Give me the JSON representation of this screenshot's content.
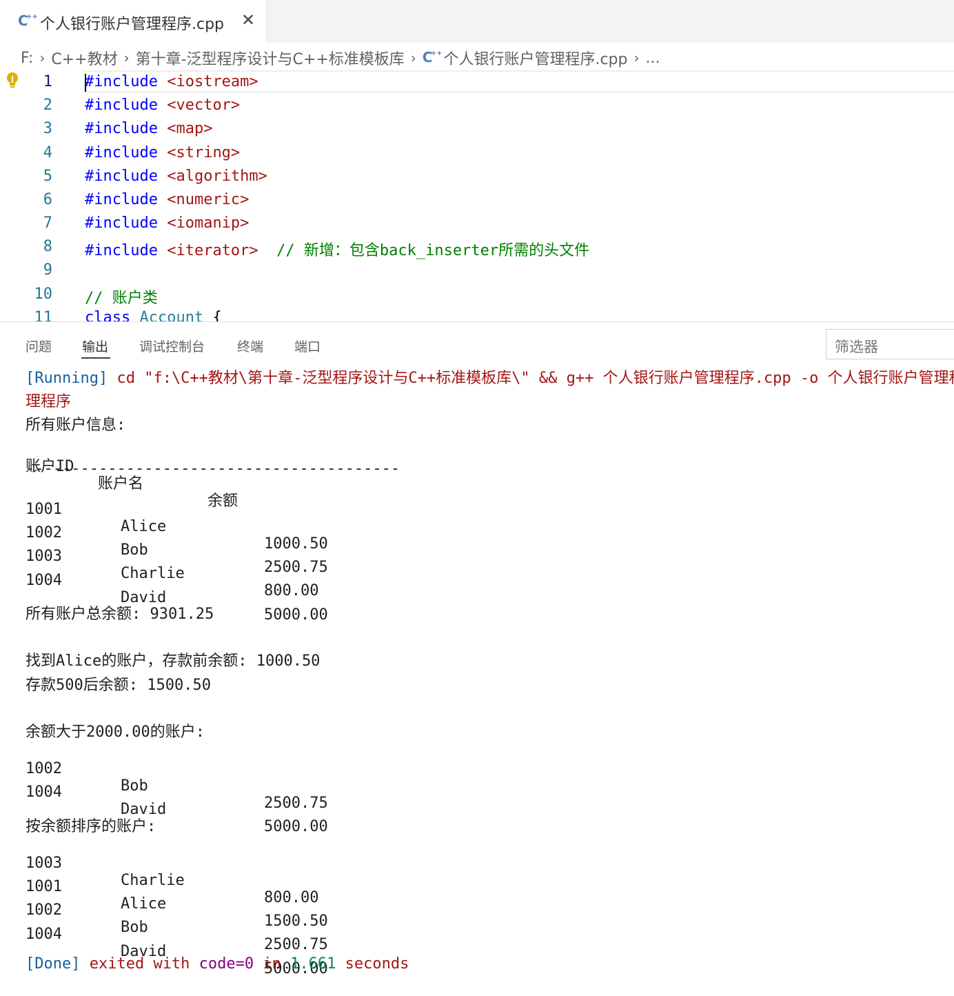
{
  "tab": {
    "title": "个人银行账户管理程序.cpp",
    "close": "✕",
    "icon": "cpp-file-icon"
  },
  "breadcrumb": {
    "drive": "F:",
    "folder1": "C++教材",
    "folder2": "第十章-泛型程序设计与C++标准模板库",
    "file": "个人银行账户管理程序.cpp",
    "more": "..."
  },
  "editor": {
    "lines": [
      {
        "n": "1",
        "kw": "#include",
        "rest": " <iostream>"
      },
      {
        "n": "2",
        "kw": "#include",
        "rest": " <vector>"
      },
      {
        "n": "3",
        "kw": "#include",
        "rest": " <map>"
      },
      {
        "n": "4",
        "kw": "#include",
        "rest": " <string>"
      },
      {
        "n": "5",
        "kw": "#include",
        "rest": " <algorithm>"
      },
      {
        "n": "6",
        "kw": "#include",
        "rest": " <numeric>"
      },
      {
        "n": "7",
        "kw": "#include",
        "rest": " <iomanip>"
      },
      {
        "n": "8",
        "kw": "#include",
        "rest": " <iterator>",
        "comment": "  // 新增：包含back_inserter所需的头文件"
      },
      {
        "n": "9"
      },
      {
        "n": "10",
        "comment": "// 账户类"
      },
      {
        "n": "11",
        "kw": "class",
        "cls": " Account",
        "brace": " {"
      }
    ]
  },
  "panel": {
    "tabs": [
      "问题",
      "输出",
      "调试控制台",
      "终端",
      "端口"
    ],
    "active_tab": "输出",
    "filter_placeholder": "筛选器"
  },
  "output": {
    "running_tag": "[Running]",
    "running_cmd": " cd \"f:\\C++教材\\第十章-泛型程序设计与C++标准模板库\\\" && g++ 个人银行账户管理程序.cpp -o 个人银行账户管理程序",
    "running_cmd_wrap": "理程序",
    "all_accounts_title": "所有账户信息:",
    "header": {
      "id": "账户ID",
      "name": "账户名",
      "balance": "余额"
    },
    "divider": "-----------------------------------------",
    "accounts": [
      {
        "id": "1001",
        "name": "Alice",
        "balance": "1000.50"
      },
      {
        "id": "1002",
        "name": "Bob",
        "balance": "2500.75"
      },
      {
        "id": "1003",
        "name": "Charlie",
        "balance": "800.00"
      },
      {
        "id": "1004",
        "name": "David",
        "balance": "5000.00"
      }
    ],
    "total": "所有账户总余额: 9301.25",
    "found": "找到Alice的账户，存款前余额: 1000.50",
    "after_deposit": "存款500后余额: 1500.50",
    "over_title": "余额大于2000.00的账户:",
    "over_accounts": [
      {
        "id": "1002",
        "name": "Bob",
        "balance": "2500.75"
      },
      {
        "id": "1004",
        "name": "David",
        "balance": "5000.00"
      }
    ],
    "sorted_title": "按余额排序的账户:",
    "sorted_accounts": [
      {
        "id": "1003",
        "name": "Charlie",
        "balance": "800.00"
      },
      {
        "id": "1001",
        "name": "Alice",
        "balance": "1500.50"
      },
      {
        "id": "1002",
        "name": "Bob",
        "balance": "2500.75"
      },
      {
        "id": "1004",
        "name": "David",
        "balance": "5000.00"
      }
    ],
    "done_tag": "[Done]",
    "done_exited": " exited with ",
    "done_code": "code=0",
    "done_in": " in ",
    "done_time": "1.661",
    "done_seconds": " seconds"
  }
}
